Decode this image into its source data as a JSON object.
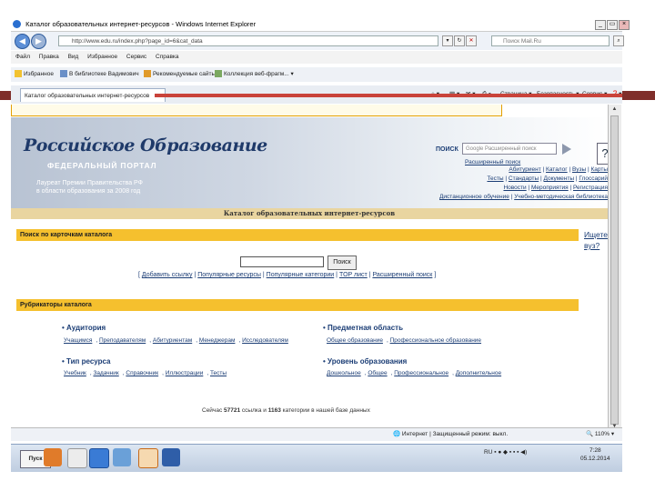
{
  "window": {
    "title": "Каталог образовательных интернет-ресурсов - Windows Internet Explorer"
  },
  "address_bar": {
    "url": "http://www.edu.ru/index.php?page_id=6&cat_data",
    "search_placeholder": "Поиск Mail.Ru"
  },
  "menu": [
    "Файл",
    "Правка",
    "Вид",
    "Избранное",
    "Сервис",
    "Справка"
  ],
  "favorites": {
    "label": "Избранное",
    "items": [
      "В библиотеке Вадимович",
      "Рекомендуемые сайты",
      "Коллекция веб-фрагм..."
    ]
  },
  "tab": {
    "label": "Каталог образовательных интернет-ресурсов"
  },
  "command_bar": [
    "Страница",
    "Безопасность",
    "Сервис"
  ],
  "banner": {
    "logo_line1": "Российское Образование",
    "logo_line2": "ФЕДЕРАЛЬНЫЙ ПОРТАЛ",
    "laureate": [
      "Лауреат Премии Правительства РФ",
      "в области образования за 2008 год"
    ],
    "search_label": "ПОИСК",
    "search_placeholder": "Google  Расширенный поиск",
    "extended_search": "Расширенный поиск",
    "help": "?"
  },
  "top_links": {
    "row1": [
      "Абитуриент",
      "Каталог",
      "Вузы",
      "Карты"
    ],
    "row2": [
      "Тесты",
      "Стандарты",
      "Документы",
      "Глоссарий"
    ],
    "row3": [
      "Новости",
      "Мероприятия",
      "Регистрация"
    ],
    "row4": [
      "Дистанционное обучение",
      "Учебно-методическая библиотека"
    ]
  },
  "catalog_title": "Каталог образовательных интернет-ресурсов",
  "search_section": {
    "header": "Поиск по карточкам каталога",
    "ishete": "Ищете вуз?",
    "button": "Поиск",
    "links": [
      "Добавить ссылку",
      "Популярные ресурсы",
      "Популярные категории",
      "TOP лист",
      "Расширенный поиск"
    ]
  },
  "rubricators": {
    "header": "Рубрикаторы каталога",
    "groups": [
      {
        "title": "Аудитория",
        "items": [
          "Учащимся",
          "Преподавателям",
          "Абитуриентам",
          "Менеджерам",
          "Исследователям"
        ]
      },
      {
        "title": "Предметная область",
        "items": [
          "Общее образование",
          "Профессиональное образование"
        ]
      },
      {
        "title": "Тип ресурса",
        "items": [
          "Учебник",
          "Задачник",
          "Справочник",
          "Иллюстрации",
          "Тесты"
        ]
      },
      {
        "title": "Уровень образования",
        "items": [
          "Дошкольное",
          "Общее",
          "Профессиональное",
          "Дополнительное"
        ]
      }
    ]
  },
  "stats": {
    "prefix": "Сейчас",
    "resources": "57721",
    "middle": "ссылка и",
    "categories": "1163",
    "suffix": "категории в нашей базе данных"
  },
  "status_bar": {
    "zone": "Интернет | Защищенный режим: выкл.",
    "zoom": "110%"
  },
  "taskbar": {
    "start": "Пуск",
    "lang": "RU",
    "time": "7:28",
    "date": "05.12.2014"
  },
  "colors": {
    "accent_red": "#7f2e2a",
    "yellow_header": "#f5c02e",
    "link_blue": "#1b3d75"
  }
}
